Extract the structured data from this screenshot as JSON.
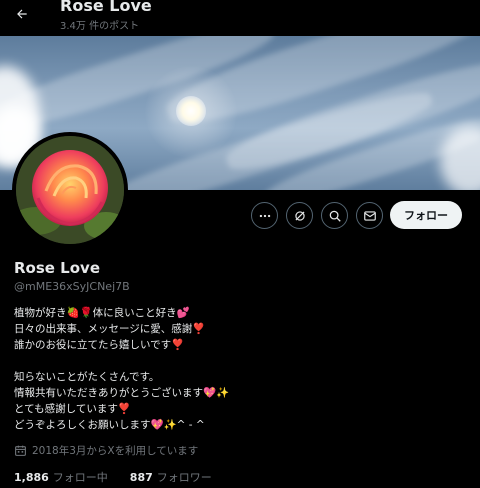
{
  "header": {
    "title": "Rose Love",
    "post_count": "3.4万 件のポスト"
  },
  "profile": {
    "name": "Rose Love",
    "handle": "@mME36xSyJCNej7B",
    "follow_label": "フォロー"
  },
  "bio": {
    "lines": [
      "植物が好き🍓🌹体に良いこと好き💕",
      "日々の出来事、メッセージに愛、感謝❣️",
      "誰かのお役に立てたら嬉しいです❣️",
      "",
      "知らないことがたくさんです。",
      "情報共有いただきありがとうございます💖✨",
      "とても感謝しています❣️",
      "どうぞよろしくお願いします💖✨^ - ^"
    ]
  },
  "joined": {
    "text": "2018年3月からXを利用しています"
  },
  "stats": {
    "following_count": "1,886",
    "following_label": "フォロー中",
    "followers_count": "887",
    "followers_label": "フォロワー"
  },
  "icons": {
    "back": "back-arrow-icon",
    "more": "more-icon",
    "grok": "grok-icon",
    "search": "search-icon",
    "message": "message-icon",
    "calendar": "calendar-icon"
  }
}
